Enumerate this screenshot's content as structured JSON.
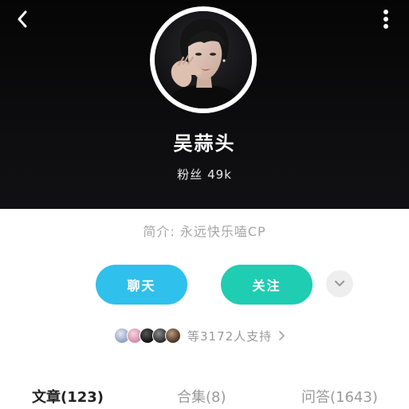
{
  "header": {
    "back_icon": "chevron-left-icon",
    "more_icon": "vertical-dots-icon",
    "avatar": "profile-photo",
    "username": "吴蒜头",
    "fans_label": "粉丝",
    "fans_count": "49k"
  },
  "profile": {
    "intro": "简介: 永远快乐嗑CP"
  },
  "actions": {
    "chat_label": "聊天",
    "follow_label": "关注",
    "chat_color": "#2fc0ec",
    "follow_color": "#1fcdb2",
    "expand_icon": "chevron-down-icon"
  },
  "supporters": {
    "text": "等3172人支持",
    "arrow_icon": "chevron-right-icon"
  },
  "tabs": [
    {
      "label": "文章(123)",
      "active": true
    },
    {
      "label": "合集(8)",
      "active": false
    },
    {
      "label": "问答(1643)",
      "active": false
    }
  ]
}
